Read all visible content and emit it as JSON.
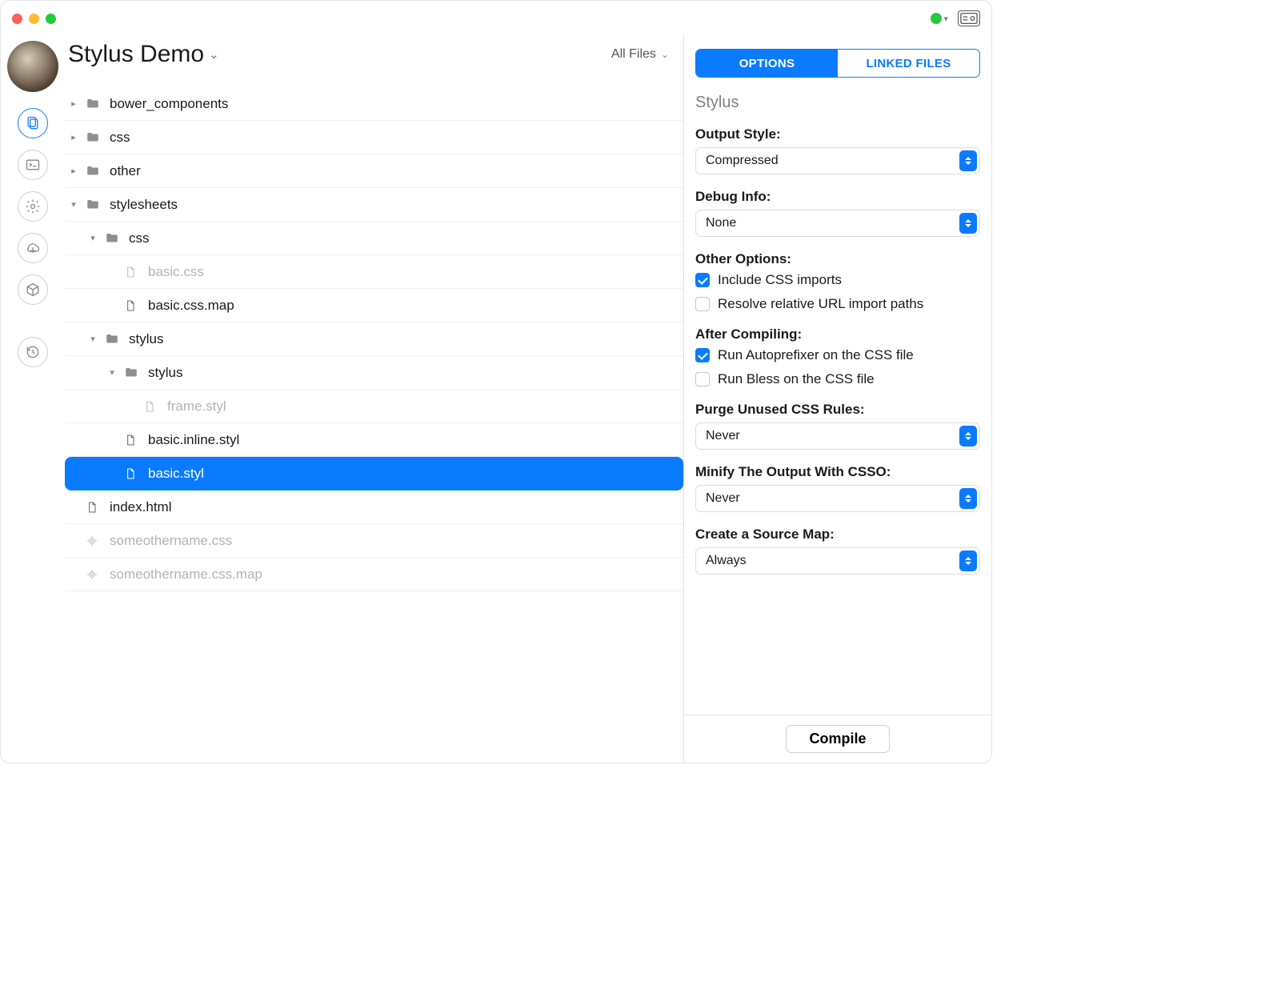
{
  "project": {
    "title": "Stylus Demo",
    "filter_label": "All Files"
  },
  "tree": {
    "items": [
      {
        "level": 0,
        "type": "folder",
        "label": "bower_components",
        "expanded": false,
        "dim": false
      },
      {
        "level": 0,
        "type": "folder",
        "label": "css",
        "expanded": false,
        "dim": false
      },
      {
        "level": 0,
        "type": "folder",
        "label": "other",
        "expanded": false,
        "dim": false
      },
      {
        "level": 0,
        "type": "folder",
        "label": "stylesheets",
        "expanded": true,
        "dim": false
      },
      {
        "level": 1,
        "type": "folder",
        "label": "css",
        "expanded": true,
        "dim": false
      },
      {
        "level": 2,
        "type": "file",
        "label": "basic.css",
        "dim": true
      },
      {
        "level": 2,
        "type": "file",
        "label": "basic.css.map",
        "dim": false
      },
      {
        "level": 1,
        "type": "folder",
        "label": "stylus",
        "expanded": true,
        "dim": false
      },
      {
        "level": 2,
        "type": "folder",
        "label": "stylus",
        "expanded": true,
        "dim": false
      },
      {
        "level": 3,
        "type": "file",
        "label": "frame.styl",
        "dim": true
      },
      {
        "level": 2,
        "type": "file",
        "label": "basic.inline.styl",
        "dim": false
      },
      {
        "level": 2,
        "type": "file",
        "label": "basic.styl",
        "dim": false,
        "selected": true
      },
      {
        "level": 0,
        "type": "file",
        "label": "index.html",
        "dim": false
      },
      {
        "level": 0,
        "type": "target",
        "label": "someothername.css",
        "dim": true
      },
      {
        "level": 0,
        "type": "target",
        "label": "someothername.css.map",
        "dim": true
      }
    ]
  },
  "panel": {
    "tabs": {
      "options": "OPTIONS",
      "linked": "LINKED FILES"
    },
    "language": "Stylus",
    "sections": {
      "output_style": {
        "label": "Output Style:",
        "value": "Compressed"
      },
      "debug_info": {
        "label": "Debug Info:",
        "value": "None"
      },
      "other_options": {
        "label": "Other Options:",
        "opt1": {
          "label": "Include CSS imports",
          "checked": true
        },
        "opt2": {
          "label": "Resolve relative URL import paths",
          "checked": false
        }
      },
      "after_compiling": {
        "label": "After Compiling:",
        "opt1": {
          "label": "Run Autoprefixer on the CSS file",
          "checked": true
        },
        "opt2": {
          "label": "Run Bless on the CSS file",
          "checked": false
        }
      },
      "purge": {
        "label": "Purge Unused CSS Rules:",
        "value": "Never"
      },
      "minify": {
        "label": "Minify The Output With CSSO:",
        "value": "Never"
      },
      "sourcemap": {
        "label": "Create a Source Map:",
        "value": "Always"
      }
    },
    "compile_button": "Compile"
  }
}
